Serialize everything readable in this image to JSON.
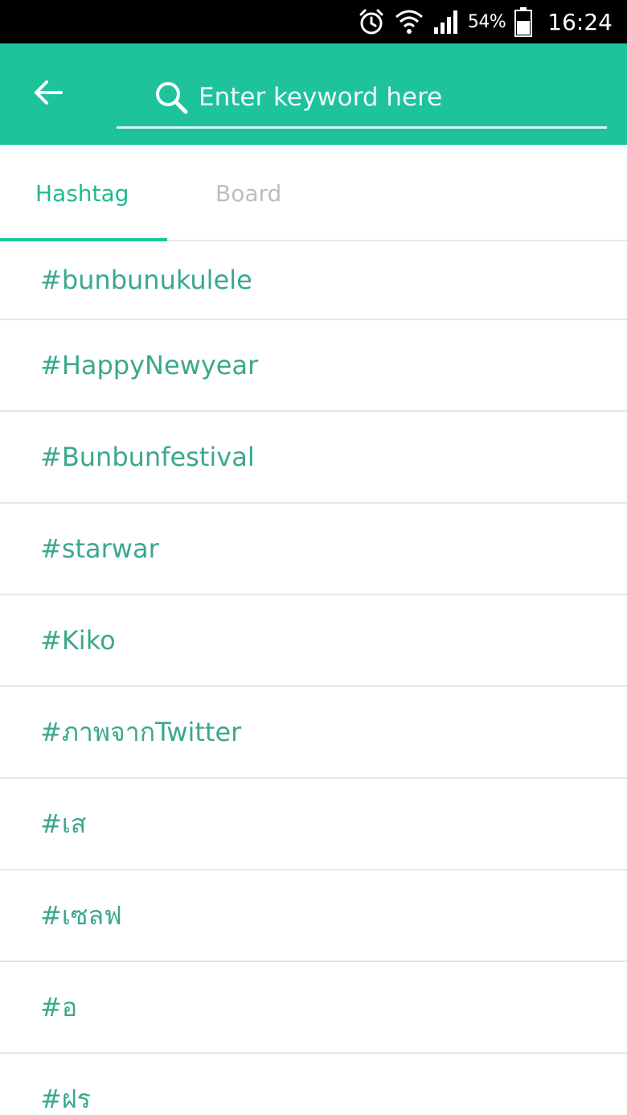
{
  "status_bar": {
    "battery_percent": "54%",
    "time": "16:24",
    "icons": [
      "alarm-icon",
      "wifi-icon",
      "signal-icon",
      "battery-icon"
    ]
  },
  "app_bar": {
    "back_icon": "arrow-left-icon",
    "search_icon": "search-icon",
    "search_placeholder": "Enter keyword here",
    "search_value": ""
  },
  "tabs": [
    {
      "label": "Hashtag",
      "active": true
    },
    {
      "label": "Board",
      "active": false
    }
  ],
  "hashtags": [
    "#bunbunukulele",
    "#HappyNewyear",
    "#Bunbunfestival",
    "#starwar",
    "#Kiko",
    "#ภาพจากTwitter",
    "#เส",
    "#เซลฟ",
    "#อ",
    "#ฝร"
  ],
  "colors": {
    "accent": "#1ec39c",
    "hashtag_text": "#3aa88d",
    "inactive_tab": "#bdbdbd",
    "divider": "#e6e6e6"
  }
}
